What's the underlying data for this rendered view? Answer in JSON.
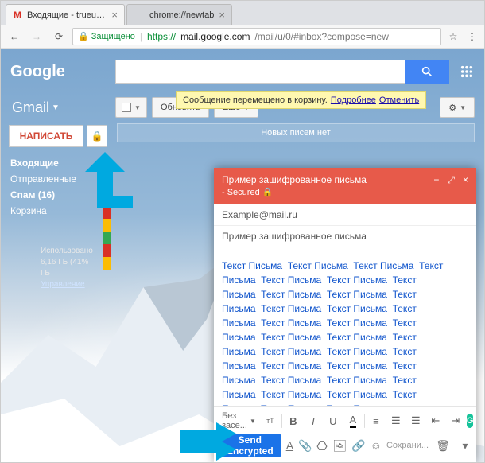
{
  "browser": {
    "tabs": [
      {
        "title": "Входящие - trueundelet",
        "favicon": "M"
      },
      {
        "title": "chrome://newtab",
        "favicon": ""
      }
    ],
    "secure_label": "Защищено",
    "url_proto": "https://",
    "url_host": "mail.google.com",
    "url_path": "/mail/u/0/#inbox?compose=new"
  },
  "gmail": {
    "logo": "Google",
    "brand": "Gmail",
    "search_placeholder": "",
    "notice": {
      "text": "Сообщение перемещено в корзину.",
      "more": "Подробнее",
      "undo": "Отменить"
    },
    "toolbar": {
      "refresh": "Обновить",
      "more": "Ещё"
    },
    "compose_label": "НАПИСАТЬ",
    "nav": [
      {
        "label": "Входящие",
        "selected": true
      },
      {
        "label": "Отправленные",
        "selected": false
      },
      {
        "label": "Спам (16)",
        "selected": true
      },
      {
        "label": "Корзина",
        "selected": false
      }
    ],
    "categories_colors": [
      "#d93025",
      "#34a853",
      "#1a73e8",
      "#d93025",
      "#fbbc04",
      "#34a853",
      "#d93025",
      "#fbbc04"
    ],
    "storage": {
      "line1": "Использовано 6,16 ГБ (41%",
      "line2": "ГБ",
      "manage": "Управление"
    },
    "empty_text": "Новых писем нет"
  },
  "composer": {
    "subject_title": "Пример зашифрованное письма",
    "secured": "- Secured",
    "to": "Example@mail.ru",
    "subject": "Пример зашифрованное письма",
    "body_repeat": "Текст Письма",
    "body_sep": "----------",
    "font_label": "Без засе...",
    "send_label": "Send Encrypted",
    "saved_label": "Сохрани..."
  }
}
